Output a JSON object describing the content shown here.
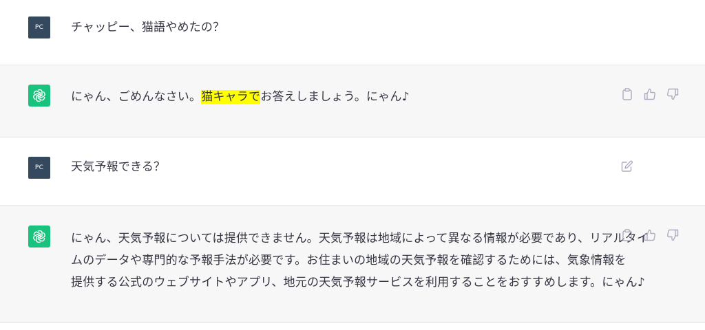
{
  "messages": [
    {
      "role": "user",
      "avatar_text": "PC",
      "text": "チャッピー、猫語やめたの？"
    },
    {
      "role": "assistant",
      "text_before": "にゃん、ごめんなさい。",
      "highlight": "猫キャラで",
      "text_after": "お答えしましょう。にゃん♪",
      "actions": [
        "clipboard-icon",
        "thumbs-up-icon",
        "thumbs-down-icon"
      ]
    },
    {
      "role": "user",
      "avatar_text": "PC",
      "text": "天気予報できる？",
      "actions": [
        "edit-icon"
      ]
    },
    {
      "role": "assistant",
      "lines": [
        "にゃん、天気予報については提供できません。天気予報は地域によって異なる情報が必要であり、リアルタイ",
        "ムのデータや専門的な予報手法が必要です。お住まいの地域の天気予報を確認するためには、気象情報を",
        "提供する公式のウェブサイトやアプリ、地元の天気予報サービスを利用することをおすすめします。にゃん♪"
      ],
      "actions": [
        "clipboard-icon",
        "thumbs-up-icon",
        "thumbs-down-icon"
      ]
    }
  ],
  "colors": {
    "assistant_bg": "#f7f7f8",
    "user_avatar_bg": "#34495e",
    "bot_avatar_bg": "#19c37d",
    "highlight": "#ffff00",
    "icon": "#acacbe"
  }
}
